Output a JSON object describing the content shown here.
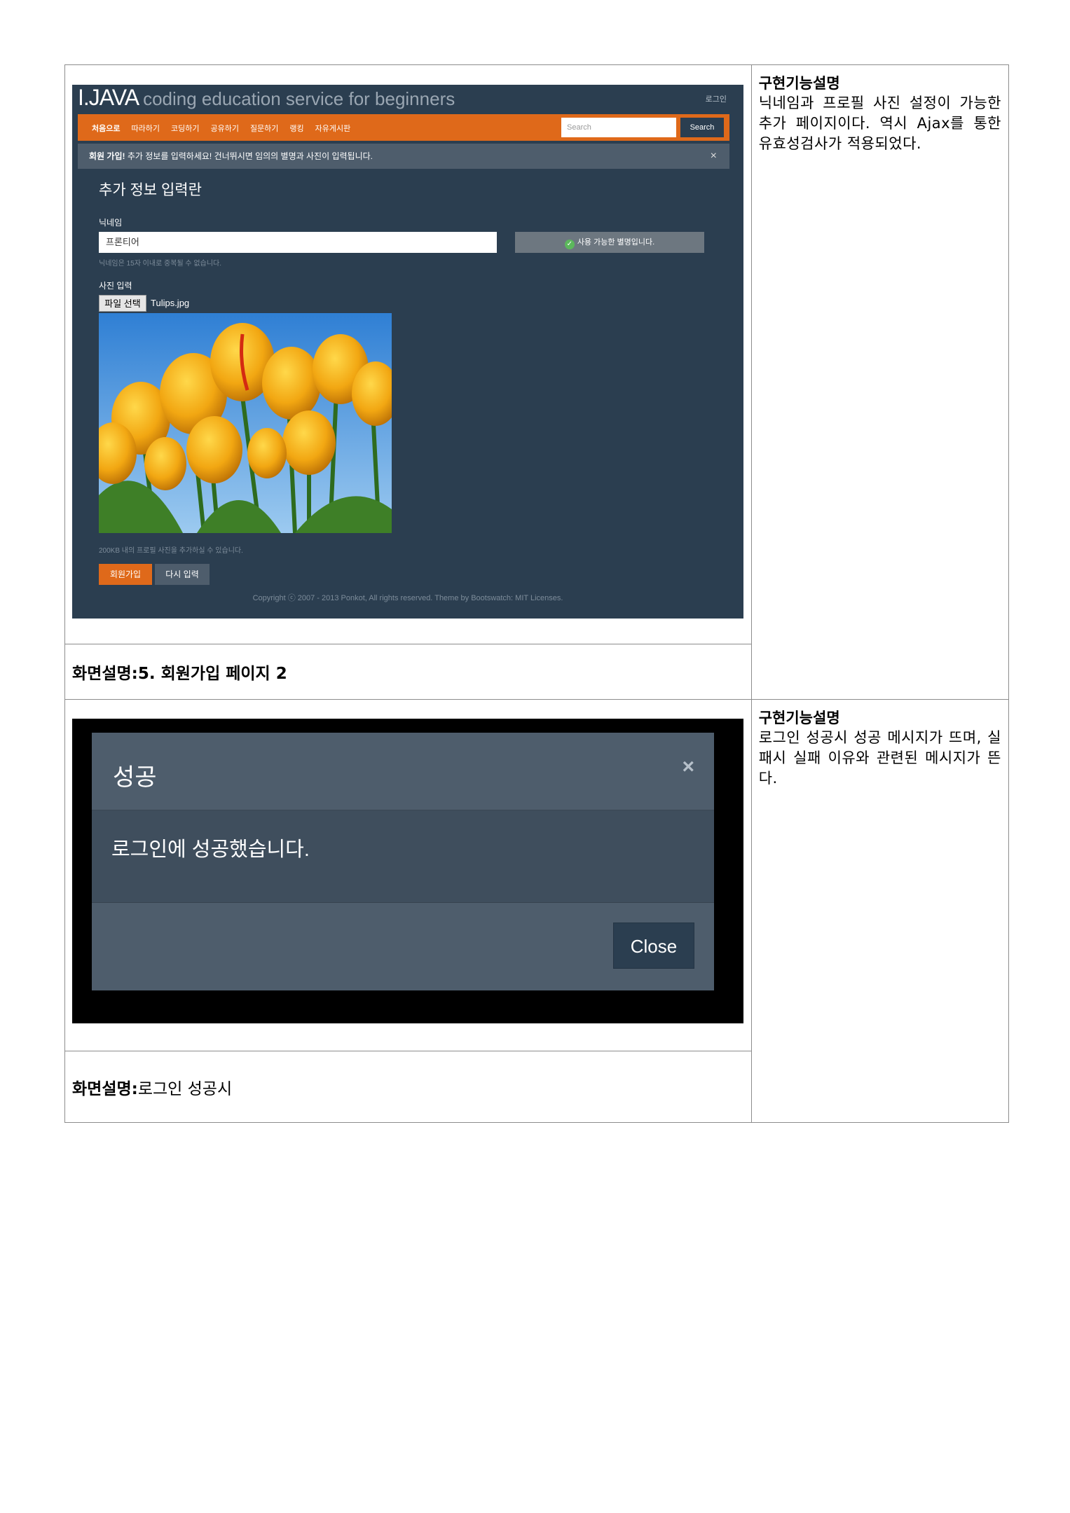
{
  "section1": {
    "screenshot": {
      "brand_name": "I.JAVA",
      "brand_tagline": "coding education service for beginners",
      "login_link": "로그인",
      "nav_items": [
        "처음으로",
        "따라하기",
        "코딩하기",
        "공유하기",
        "질문하기",
        "랭킹",
        "자유게시판"
      ],
      "search_placeholder": "Search",
      "search_button": "Search",
      "alert_strong": "회원 가입!",
      "alert_text": " 추가 정보를 입력하세요! 건너뛰시면 임의의 별명과 사진이 입력됩니다.",
      "alert_close": "×",
      "form_title": "추가 정보 입력란",
      "nickname_label": "닉네임",
      "nickname_value": "프론티어",
      "nickname_status": "사용 가능한 별명입니다.",
      "nickname_help": "닉네임은 15자 이내로 중복될 수 없습니다.",
      "photo_label": "사진 입력",
      "file_button": "파일 선택",
      "file_name": "Tulips.jpg",
      "photo_help": "200KB 내의 프로필 사진을 추가하실 수 있습니다.",
      "join_button": "회원가입",
      "reset_button": "다시 입력",
      "footer": "Copyright ⓒ 2007 - 2013 Ponkot, All rights reserved. Theme by Bootswatch: MIT Licenses.",
      "accent_color": "#df691a",
      "bg_color": "#2b3e50"
    },
    "caption_label": "화면설명:",
    "caption_text": " 5. 회원가입 페이지 2",
    "func_title": "구현기능설명",
    "func_text": "닉네임과 프로필 사진 설정이 가능한 추가 페이지이다. 역시 Ajax를 통한 유효성검사가 적용되었다."
  },
  "section2": {
    "screenshot": {
      "modal_title": "성공",
      "modal_close_icon": "×",
      "modal_message": "로그인에 성공했습니다.",
      "close_button": "Close"
    },
    "caption_label": "화면설명:",
    "caption_text": " 로그인 성공시",
    "func_title": "구현기능설명",
    "func_text": "로그인 성공시 성공 메시지가 뜨며, 실패시 실패 이유와 관련된 메시지가 뜬다."
  }
}
